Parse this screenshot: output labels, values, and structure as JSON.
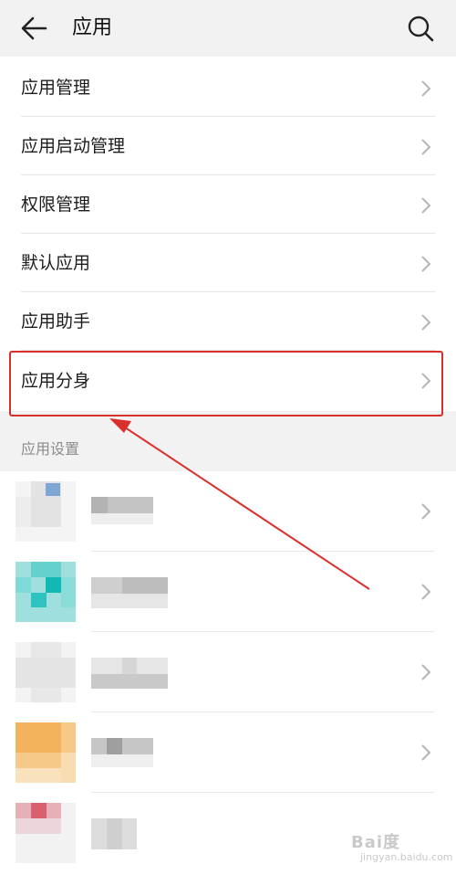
{
  "header": {
    "title": "应用",
    "back_icon": "arrow-left-icon",
    "search_icon": "search-icon"
  },
  "menu": {
    "items": [
      {
        "label": "应用管理"
      },
      {
        "label": "应用启动管理"
      },
      {
        "label": "权限管理"
      },
      {
        "label": "默认应用"
      },
      {
        "label": "应用助手"
      },
      {
        "label": "应用分身"
      }
    ]
  },
  "highlight": {
    "target": "应用分身",
    "color": "#d9302c"
  },
  "section": {
    "title": "应用设置"
  },
  "apps": [
    {
      "icon": "blurred-app-icon",
      "name_visible": false
    },
    {
      "icon": "blurred-app-icon",
      "name_visible": false
    },
    {
      "icon": "blurred-app-icon",
      "name_visible": false
    },
    {
      "icon": "blurred-app-icon",
      "name_visible": false
    },
    {
      "icon": "blurred-app-icon",
      "name_visible": false
    }
  ],
  "watermark": {
    "logo": "Bai度",
    "sub": "jingyan.baidu.com"
  }
}
